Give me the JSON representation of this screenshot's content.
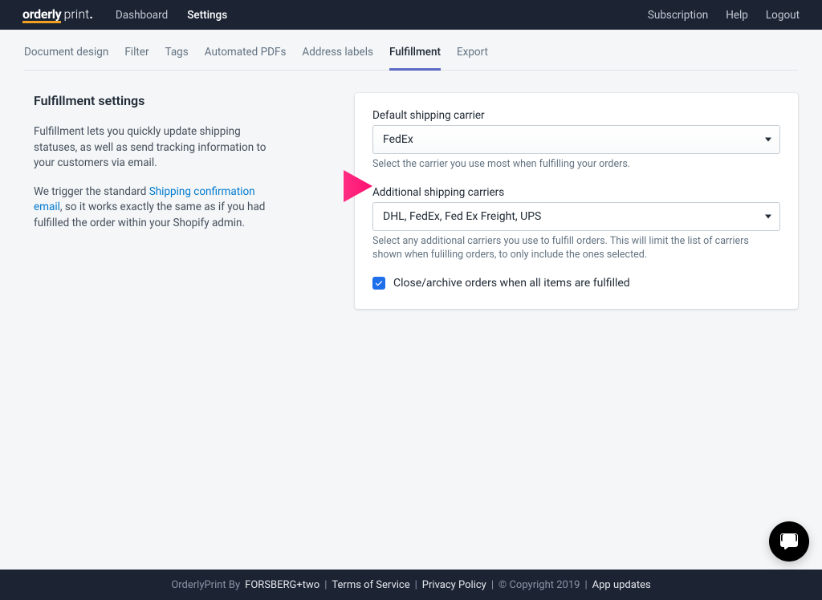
{
  "brand": {
    "bold": "orderly",
    "thin": "print"
  },
  "topnav": {
    "dashboard": "Dashboard",
    "settings": "Settings",
    "subscription": "Subscription",
    "help": "Help",
    "logout": "Logout"
  },
  "subnav": {
    "items": [
      "Document design",
      "Filter",
      "Tags",
      "Automated PDFs",
      "Address labels",
      "Fulfillment",
      "Export"
    ],
    "active": "Fulfillment"
  },
  "left": {
    "heading": "Fulfillment settings",
    "p1": "Fulfillment lets you quickly update shipping statuses, as well as send tracking information to your customers via email.",
    "p2a": "We trigger the standard ",
    "p2link": "Shipping confirmation email",
    "p2b": ", so it works exactly the same as if you had fulfilled the order within your Shopify admin."
  },
  "form": {
    "default_label": "Default shipping carrier",
    "default_value": "FedEx",
    "default_help": "Select the carrier you use most when fulfilling your orders.",
    "additional_label": "Additional shipping carriers",
    "additional_value": "DHL, FedEx, Fed Ex Freight, UPS",
    "additional_help": "Select any additional carriers you use to fulfill orders. This will limit the list of carriers shown when fulilling orders, to only include the ones selected.",
    "close_label": "Close/archive orders when all items are fulfilled"
  },
  "footer": {
    "pre": "OrderlyPrint By ",
    "by": "FORSBERG+two",
    "sep": " | ",
    "tos": "Terms of Service",
    "pp": "Privacy Policy",
    "copy": " © Copyright 2019 ",
    "updates": "App updates"
  }
}
